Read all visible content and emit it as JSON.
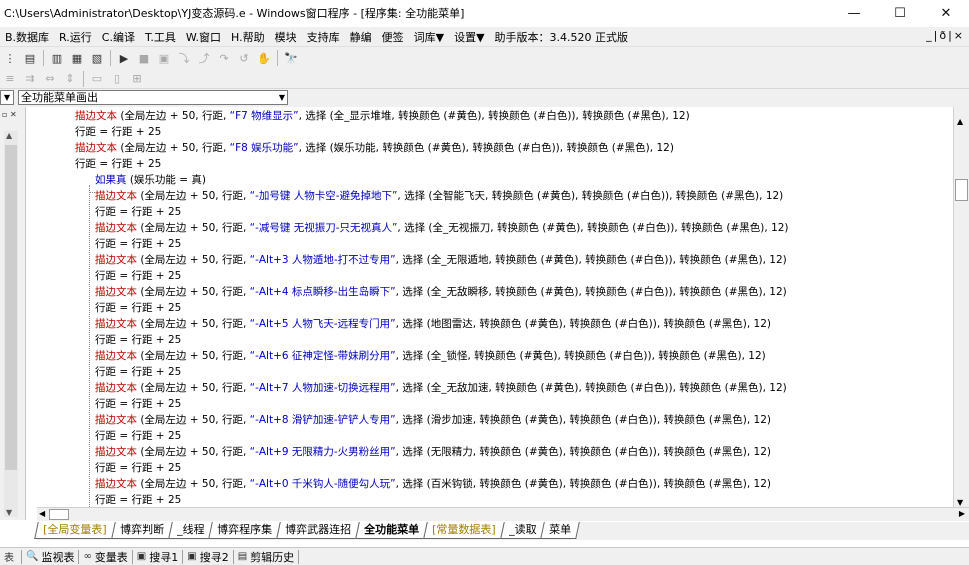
{
  "window": {
    "title": "C:\\Users\\Administrator\\Desktop\\YJ变态源码.e - Windows窗口程序 - [程序集: 全功能菜单]",
    "minimize": "—",
    "maximize": "☐",
    "close": "✕"
  },
  "menu": {
    "items": [
      "B.数据库",
      "R.运行",
      "C.编译",
      "T.工具",
      "W.窗口",
      "H.帮助",
      "模块",
      "支持库",
      "静编",
      "便签",
      "词库▼",
      "设置▼",
      "助手版本：3.4.520 正式版"
    ],
    "mdi_controls": "_|ð|×"
  },
  "combo": {
    "value": "全功能菜单画出"
  },
  "code": {
    "lines": [
      {
        "indent": 38,
        "cmd": "描边文本",
        "args": " (全局左边 + 50, 行距, ",
        "str": "“F7 物维显示”",
        "rest": ", 选择 (全_显示堆堆, 转换颜色 (#黄色), 转换颜色 (#白色)), 转换颜色 (#黑色), 12)"
      },
      {
        "indent": 38,
        "cmd": "行距 = 行距 + 25",
        "args": "",
        "str": "",
        "rest": ""
      },
      {
        "indent": 38,
        "cmd": "描边文本",
        "args": " (全局左边 + 50, 行距, ",
        "str": "“F8 娱乐功能”",
        "rest": ", 选择 (娱乐功能, 转换颜色 (#黄色), 转换颜色 (#白色)), 转换颜色 (#黑色), 12)"
      },
      {
        "indent": 38,
        "cmd": "行距 = 行距 + 25",
        "args": "",
        "str": "",
        "rest": ""
      },
      {
        "indent": 58,
        "cmd": "如果真",
        "args": " (娱乐功能 = 真)",
        "str": "",
        "rest": ""
      },
      {
        "indent": 58,
        "cmd": "描边文本",
        "args": " (全局左边 + 50, 行距, ",
        "str": "“-加号键  人物卡空-避免掉地下”",
        "rest": ", 选择 (全智能飞天, 转换颜色 (#黄色), 转换颜色 (#白色)), 转换颜色 (#黑色), 12)"
      },
      {
        "indent": 58,
        "cmd": "行距 = 行距 + 25",
        "args": "",
        "str": "",
        "rest": ""
      },
      {
        "indent": 58,
        "cmd": "描边文本",
        "args": " (全局左边 + 50, 行距, ",
        "str": "“-减号键  无视振刀-只无视真人”",
        "rest": ", 选择 (全_无视振刀, 转换颜色 (#黄色), 转换颜色 (#白色)), 转换颜色 (#黑色), 12)"
      },
      {
        "indent": 58,
        "cmd": "行距 = 行距 + 25",
        "args": "",
        "str": "",
        "rest": ""
      },
      {
        "indent": 58,
        "cmd": "描边文本",
        "args": " (全局左边 + 50, 行距, ",
        "str": "“-Alt+3  人物遁地-打不过专用”",
        "rest": ", 选择 (全_无限遁地, 转换颜色 (#黄色), 转换颜色 (#白色)), 转换颜色 (#黑色), 12)"
      },
      {
        "indent": 58,
        "cmd": "行距 = 行距 + 25",
        "args": "",
        "str": "",
        "rest": ""
      },
      {
        "indent": 58,
        "cmd": "描边文本",
        "args": " (全局左边 + 50, 行距, ",
        "str": "“-Alt+4  标点瞬移-出生岛瞬下”",
        "rest": ", 选择 (全_无敌瞬移, 转换颜色 (#黄色), 转换颜色 (#白色)), 转换颜色 (#黑色), 12)"
      },
      {
        "indent": 58,
        "cmd": "行距 = 行距 + 25",
        "args": "",
        "str": "",
        "rest": ""
      },
      {
        "indent": 58,
        "cmd": "描边文本",
        "args": " (全局左边 + 50, 行距, ",
        "str": "“-Alt+5  人物飞天-远程专门用”",
        "rest": ", 选择 (地图雷达, 转换颜色 (#黄色), 转换颜色 (#白色)), 转换颜色 (#黑色), 12)"
      },
      {
        "indent": 58,
        "cmd": "行距 = 行距 + 25",
        "args": "",
        "str": "",
        "rest": ""
      },
      {
        "indent": 58,
        "cmd": "描边文本",
        "args": " (全局左边 + 50, 行距, ",
        "str": "“-Alt+6  征神定怪-带妹刷分用”",
        "rest": ", 选择 (全_锁怪, 转换颜色 (#黄色), 转换颜色 (#白色)), 转换颜色 (#黑色), 12)"
      },
      {
        "indent": 58,
        "cmd": "行距 = 行距 + 25",
        "args": "",
        "str": "",
        "rest": ""
      },
      {
        "indent": 58,
        "cmd": "描边文本",
        "args": " (全局左边 + 50, 行距, ",
        "str": "“-Alt+7  人物加速-切换远程用”",
        "rest": ", 选择 (全_无敌加速, 转换颜色 (#黄色), 转换颜色 (#白色)), 转换颜色 (#黑色), 12)"
      },
      {
        "indent": 58,
        "cmd": "行距 = 行距 + 25",
        "args": "",
        "str": "",
        "rest": ""
      },
      {
        "indent": 58,
        "cmd": "描边文本",
        "args": " (全局左边 + 50, 行距, ",
        "str": "“-Alt+8  滑铲加速-铲铲人专用”",
        "rest": ", 选择 (滑步加速, 转换颜色 (#黄色), 转换颜色 (#白色)), 转换颜色 (#黑色), 12)"
      },
      {
        "indent": 58,
        "cmd": "行距 = 行距 + 25",
        "args": "",
        "str": "",
        "rest": ""
      },
      {
        "indent": 58,
        "cmd": "描边文本",
        "args": " (全局左边 + 50, 行距, ",
        "str": "“-Alt+9  无限精力-火男粉丝用”",
        "rest": ", 选择 (无限精力, 转换颜色 (#黄色), 转换颜色 (#白色)), 转换颜色 (#黑色), 12)"
      },
      {
        "indent": 58,
        "cmd": "行距 = 行距 + 25",
        "args": "",
        "str": "",
        "rest": ""
      },
      {
        "indent": 58,
        "cmd": "描边文本",
        "args": " (全局左边 + 50, 行距, ",
        "str": "“-Alt+0  千米钩人-随便勾人玩”",
        "rest": ", 选择 (百米钩锁, 转换颜色 (#黄色), 转换颜色 (#白色)), 转换颜色 (#黑色), 12)"
      },
      {
        "indent": 58,
        "cmd": "行距 = 行距 + 25",
        "args": "",
        "str": "",
        "rest": ""
      }
    ]
  },
  "tabs": [
    {
      "label": "[全局变量表]",
      "style": "yellow"
    },
    {
      "label": "博弈判断",
      "style": ""
    },
    {
      "label": "_线程",
      "style": ""
    },
    {
      "label": "博弈程序集",
      "style": ""
    },
    {
      "label": "博弈武器连招",
      "style": ""
    },
    {
      "label": "全功能菜单",
      "style": "active"
    },
    {
      "label": "[常量数据表]",
      "style": "yellow"
    },
    {
      "label": "_读取",
      "style": ""
    },
    {
      "label": "菜单",
      "style": ""
    }
  ],
  "status": {
    "items": [
      {
        "icon": "表",
        "label": ""
      },
      {
        "icon": "🔍",
        "label": "监视表"
      },
      {
        "icon": "∞",
        "label": "变量表"
      },
      {
        "icon": "▣",
        "label": "搜寻1"
      },
      {
        "icon": "▣",
        "label": "搜寻2"
      },
      {
        "icon": "▤",
        "label": "剪辑历史"
      }
    ]
  }
}
